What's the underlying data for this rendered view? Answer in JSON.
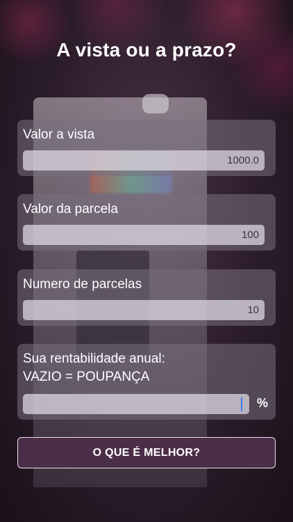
{
  "title": "A vista ou a prazo?",
  "fields": [
    {
      "label": "Valor a vista",
      "value": "1000.0"
    },
    {
      "label": "Valor da parcela",
      "value": "100"
    },
    {
      "label": "Numero de parcelas",
      "value": "10"
    }
  ],
  "rentabilidade": {
    "label_line1": "Sua rentabilidade anual:",
    "label_line2": "VAZIO = POUPANÇA",
    "value": "",
    "unit": "%"
  },
  "action_button": "O QUE É MELHOR?",
  "colors": {
    "button_bg": "#4b2e48",
    "caret": "#3b7cf0"
  }
}
